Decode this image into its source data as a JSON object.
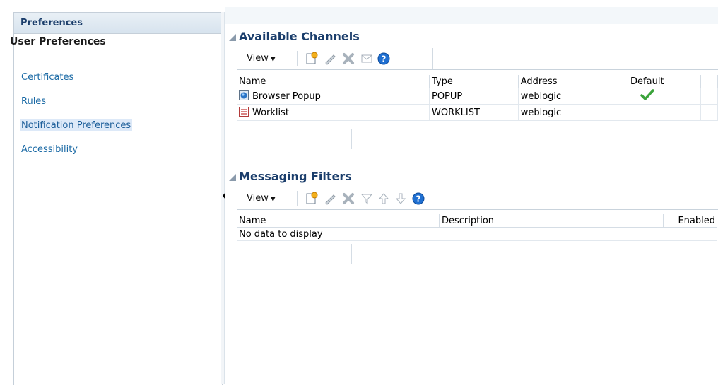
{
  "left_panel": {
    "header": "Preferences",
    "section_title": "User Preferences",
    "items": [
      {
        "label": "Certificates",
        "selected": false
      },
      {
        "label": "Rules",
        "selected": false
      },
      {
        "label": "Notification Preferences",
        "selected": true
      },
      {
        "label": "Accessibility",
        "selected": false
      }
    ]
  },
  "channels": {
    "title": "Available Channels",
    "view_label": "View",
    "toolbar_icons": [
      "create-icon",
      "edit-icon",
      "delete-icon",
      "email-icon",
      "help-icon"
    ],
    "columns": [
      "Name",
      "Type",
      "Address",
      "Default"
    ],
    "rows": [
      {
        "name": "Browser Popup",
        "icon": "browser-popup-icon",
        "type": "POPUP",
        "address": "weblogic",
        "default": true
      },
      {
        "name": "Worklist",
        "icon": "worklist-icon",
        "type": "WORKLIST",
        "address": "weblogic",
        "default": false
      }
    ]
  },
  "filters": {
    "title": "Messaging Filters",
    "view_label": "View",
    "toolbar_icons": [
      "create-icon",
      "edit-icon",
      "delete-icon",
      "filter-icon",
      "move-up-icon",
      "move-down-icon",
      "help-icon"
    ],
    "columns": [
      "Name",
      "Description",
      "Enabled"
    ],
    "empty_text": "No data to display"
  },
  "colors": {
    "link": "#1b6aa5",
    "title": "#1a3d6b",
    "selected_bg": "#dde9f8"
  }
}
